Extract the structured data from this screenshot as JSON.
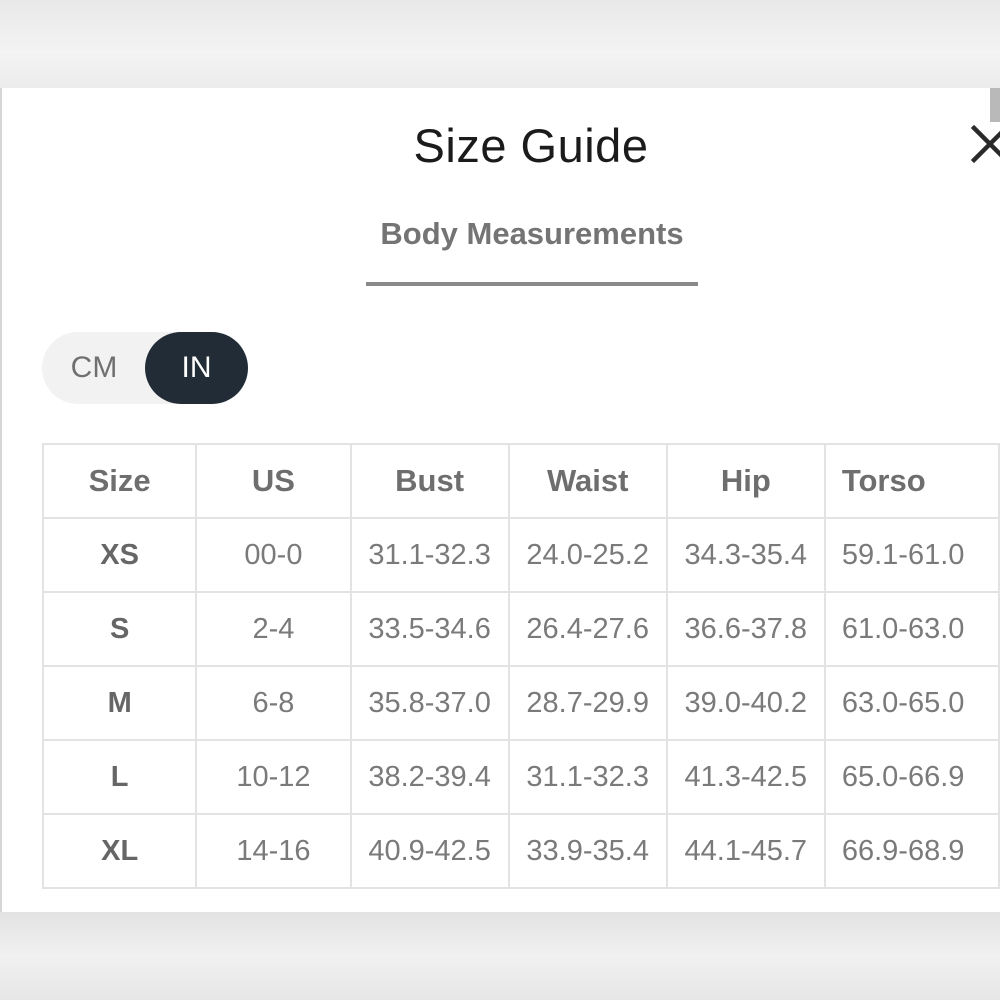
{
  "modal": {
    "title": "Size Guide",
    "close_icon": "close-icon",
    "tabs": [
      {
        "label": "Body Measurements",
        "active": true
      }
    ],
    "unit_toggle": {
      "options": [
        "CM",
        "IN"
      ],
      "selected": "IN",
      "selected_color": "#222c36"
    },
    "table": {
      "headers": [
        "Size",
        "US",
        "Bust",
        "Waist",
        "Hip",
        "Torso"
      ],
      "rows": [
        [
          "XS",
          "00-0",
          "31.1-32.3",
          "24.0-25.2",
          "34.3-35.4",
          "59.1-61.0"
        ],
        [
          "S",
          "2-4",
          "33.5-34.6",
          "26.4-27.6",
          "36.6-37.8",
          "61.0-63.0"
        ],
        [
          "M",
          "6-8",
          "35.8-37.0",
          "28.7-29.9",
          "39.0-40.2",
          "63.0-65.0"
        ],
        [
          "L",
          "10-12",
          "38.2-39.4",
          "31.1-32.3",
          "41.3-42.5",
          "65.0-66.9"
        ],
        [
          "XL",
          "14-16",
          "40.9-42.5",
          "33.9-35.4",
          "44.1-45.7",
          "66.9-68.9"
        ]
      ]
    }
  }
}
